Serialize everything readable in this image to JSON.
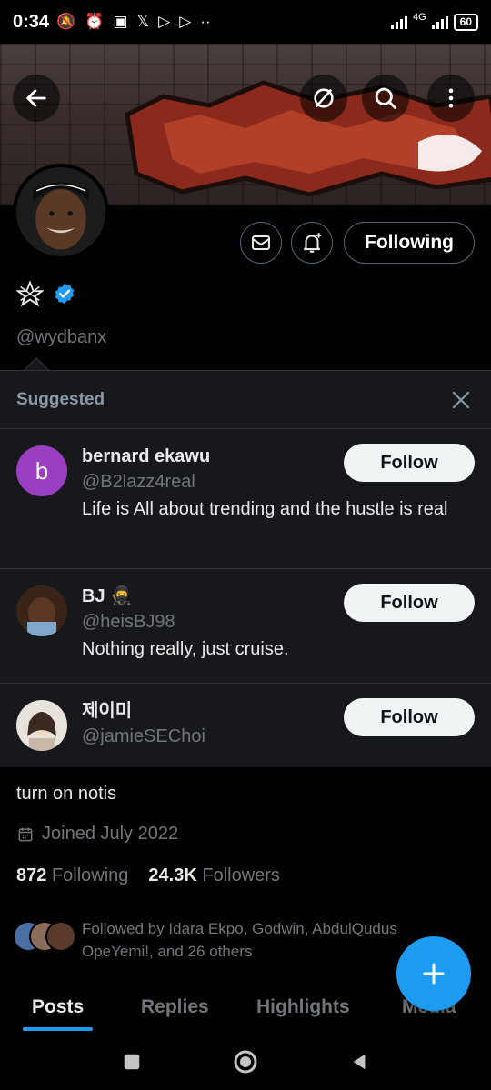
{
  "status_bar": {
    "time": "0:34",
    "network": "4G",
    "battery": "60"
  },
  "header": {
    "back_icon": "arrow-left-icon",
    "grok_icon": "slash-circle-icon",
    "search_icon": "search-icon",
    "more_icon": "more-vertical-icon"
  },
  "profile": {
    "display_name_icon": "pentagram-star-icon",
    "verified_icon": "verified-badge-icon",
    "handle": "@wydbanx",
    "following_button": "Following",
    "message_icon": "envelope-icon",
    "notify_icon": "bell-plus-icon",
    "bio": "turn on notis",
    "joined": "Joined July 2022",
    "following_count": "872",
    "following_label": "Following",
    "followers_count": "24.3K",
    "followers_label": "Followers",
    "followed_by": "Followed by Idara Ekpo, Godwin, AbdulQudus OpeYemi!, and 26 others"
  },
  "suggested": {
    "title": "Suggested",
    "close_icon": "close-icon",
    "items": [
      {
        "name": "bernard ekawu",
        "handle": "@B2lazz4real",
        "bio": "Life is All about trending and the hustle is real",
        "avatar_letter": "b",
        "avatar_color": "#9b3fc2",
        "follow": "Follow"
      },
      {
        "name": "BJ 🥷",
        "handle": "@heisBJ98",
        "bio": "Nothing really, just cruise.",
        "follow": "Follow"
      },
      {
        "name": "제이미",
        "handle": "@jamieSEChoi",
        "bio": "",
        "follow": "Follow"
      }
    ]
  },
  "tabs": [
    "Posts",
    "Replies",
    "Highlights",
    "Media"
  ],
  "fab_icon": "plus-icon",
  "colors": {
    "accent": "#1d9bf0",
    "background": "#000000",
    "panel": "#16181c",
    "muted": "#71767b"
  }
}
